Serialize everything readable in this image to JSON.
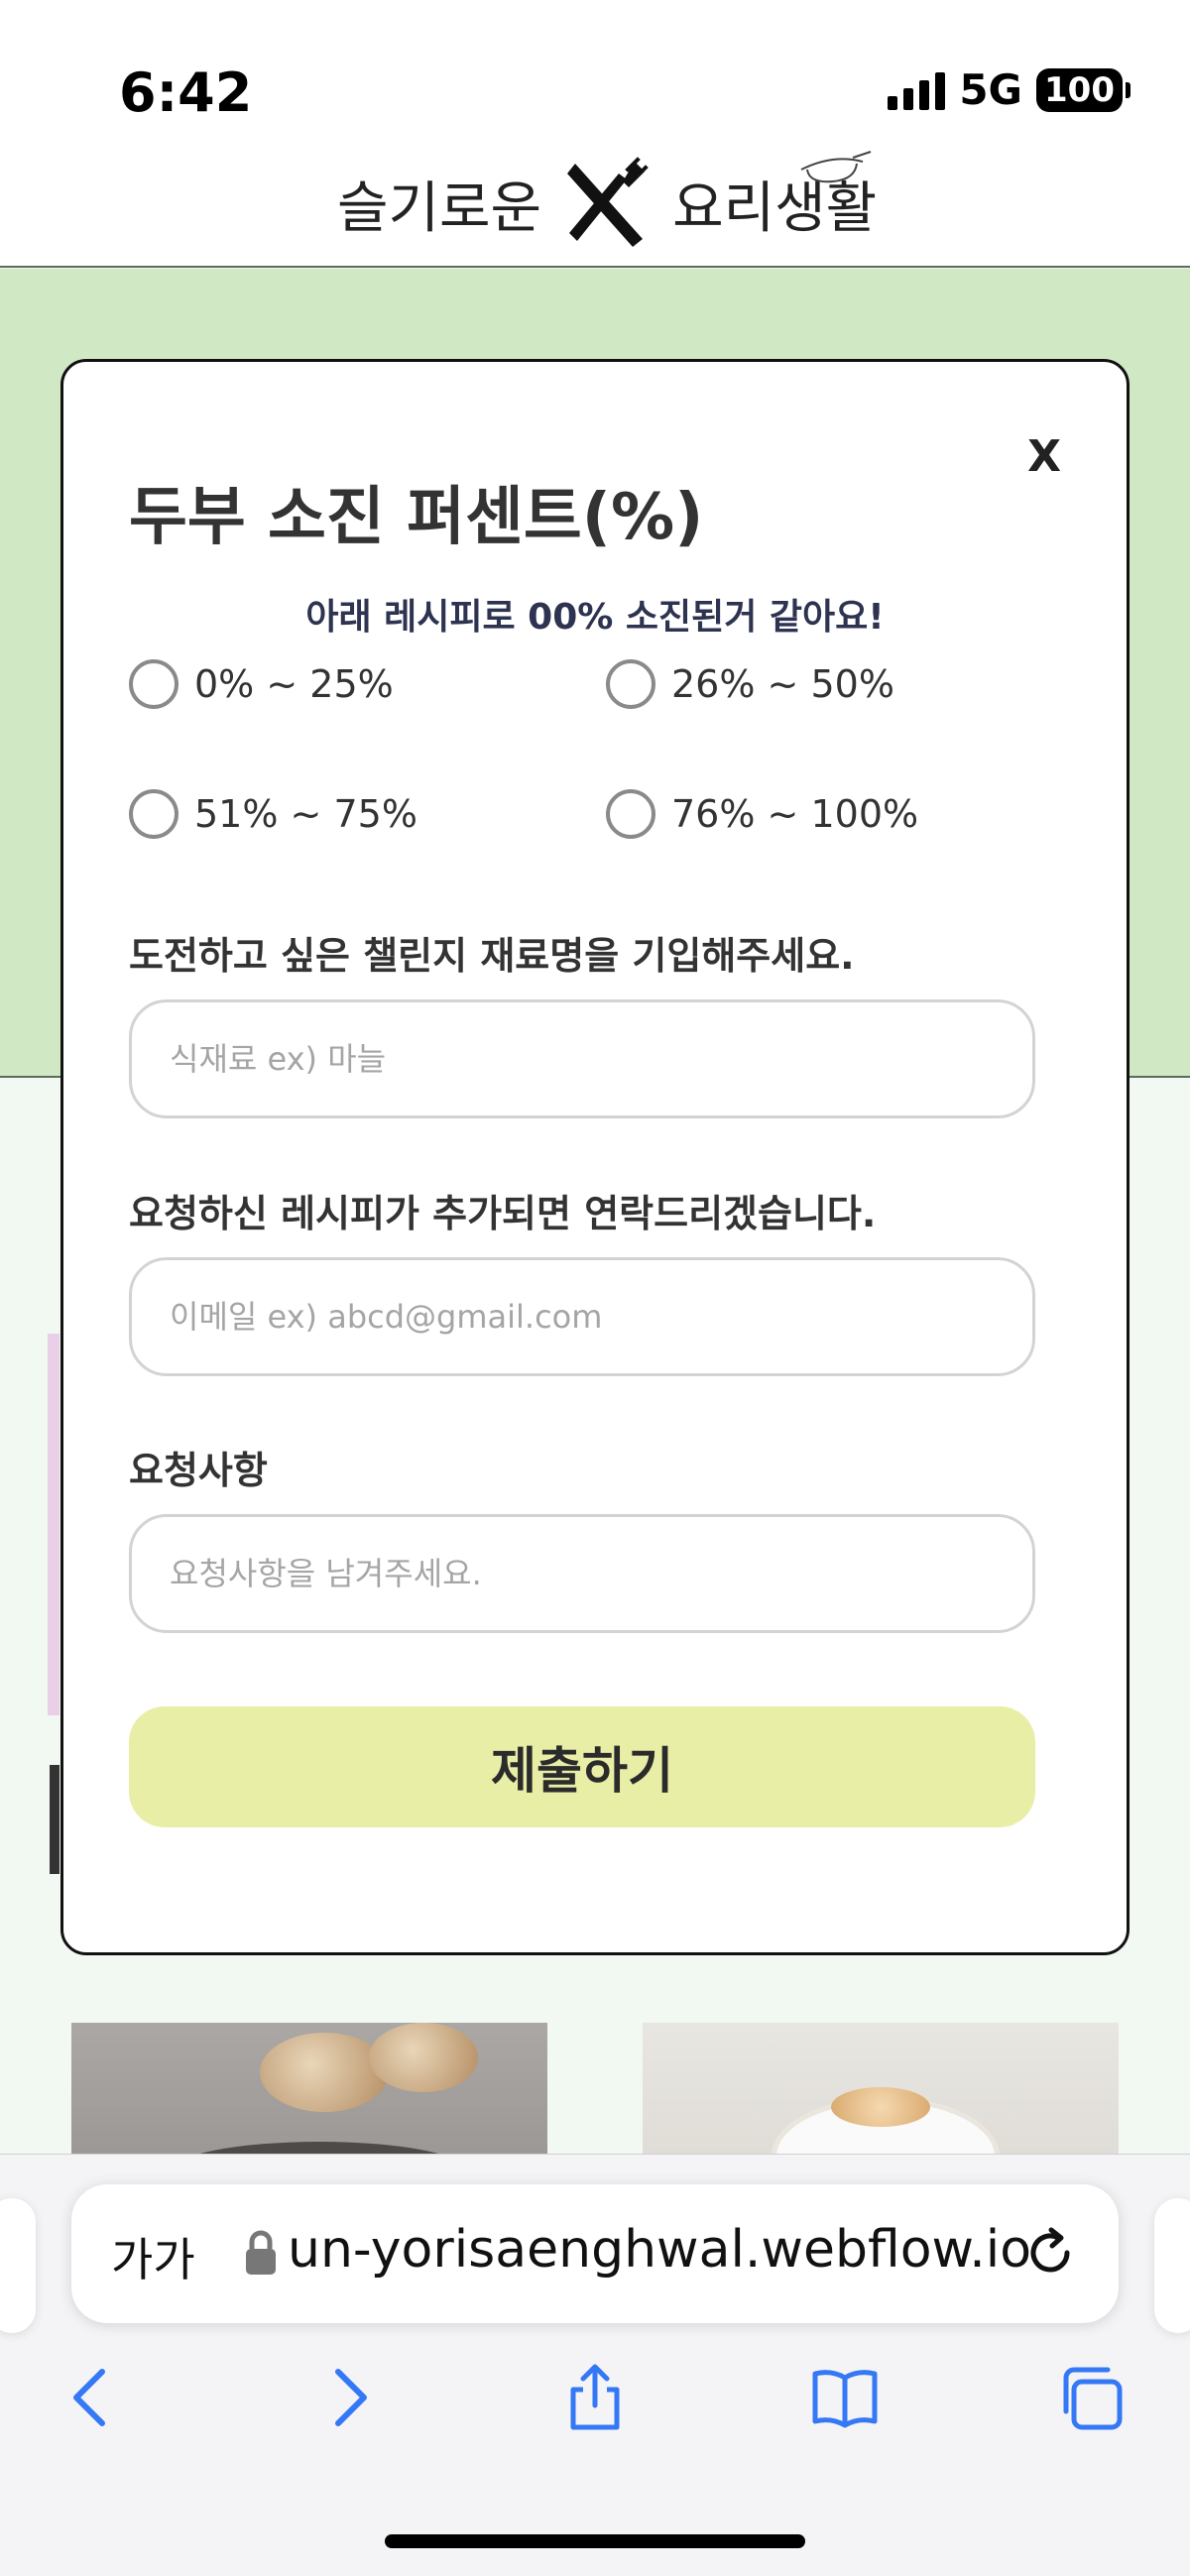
{
  "status_bar": {
    "time": "6:42",
    "network": "5G",
    "battery": "100"
  },
  "header": {
    "logo_left": "슬기로운",
    "logo_right": "요리생활"
  },
  "modal": {
    "close_label": "X",
    "title": "두부 소진 퍼센트(%)",
    "subtitle": "아래 레시피로 00% 소진된거 같아요!",
    "options": [
      "0% ~ 25%",
      "26% ~ 50%",
      "51% ~ 75%",
      "76% ~ 100%"
    ],
    "fields": [
      {
        "label": "도전하고 싶은 챌린지 재료명을 기입해주세요.",
        "placeholder": "식재료 ex) 마늘"
      },
      {
        "label": "요청하신 레시피가 추가되면 연락드리겠습니다.",
        "placeholder": "이메일 ex) abcd@gmail.com"
      },
      {
        "label": "요청사항",
        "placeholder": "요청사항을 남겨주세요."
      }
    ],
    "submit_label": "제출하기"
  },
  "browser": {
    "aa_label": "가가",
    "url": "un-yorisaenghwal.webflow.io",
    "icons": [
      "lock-icon",
      "reload-icon",
      "back-icon",
      "forward-icon",
      "share-icon",
      "bookmarks-icon",
      "tabs-icon"
    ]
  },
  "colors": {
    "green_band": "#d1e8c5",
    "submit_button": "#e8eea5",
    "subtitle_text": "#2d3350",
    "safari_blue": "#3478f6"
  }
}
